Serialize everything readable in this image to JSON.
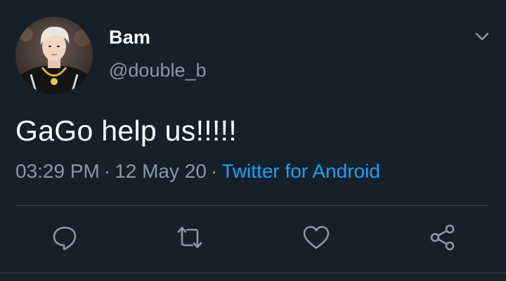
{
  "author": {
    "display_name": "Bam",
    "handle": "@double_b",
    "avatar_icon": "user-avatar-photo"
  },
  "tweet": {
    "text": "GaGo help us!!!!!"
  },
  "meta": {
    "time": "03:29 PM",
    "separator": "·",
    "date": "12 May 20",
    "source": "Twitter for Android"
  },
  "icons": {
    "menu": "chevron-down-icon",
    "reply": "reply-icon",
    "retweet": "retweet-icon",
    "like": "heart-icon",
    "share": "share-icon"
  },
  "colors": {
    "background": "#15202b",
    "text": "#ffffff",
    "secondary": "#8899a6",
    "link": "#1da1f2",
    "divider": "#38444d"
  }
}
